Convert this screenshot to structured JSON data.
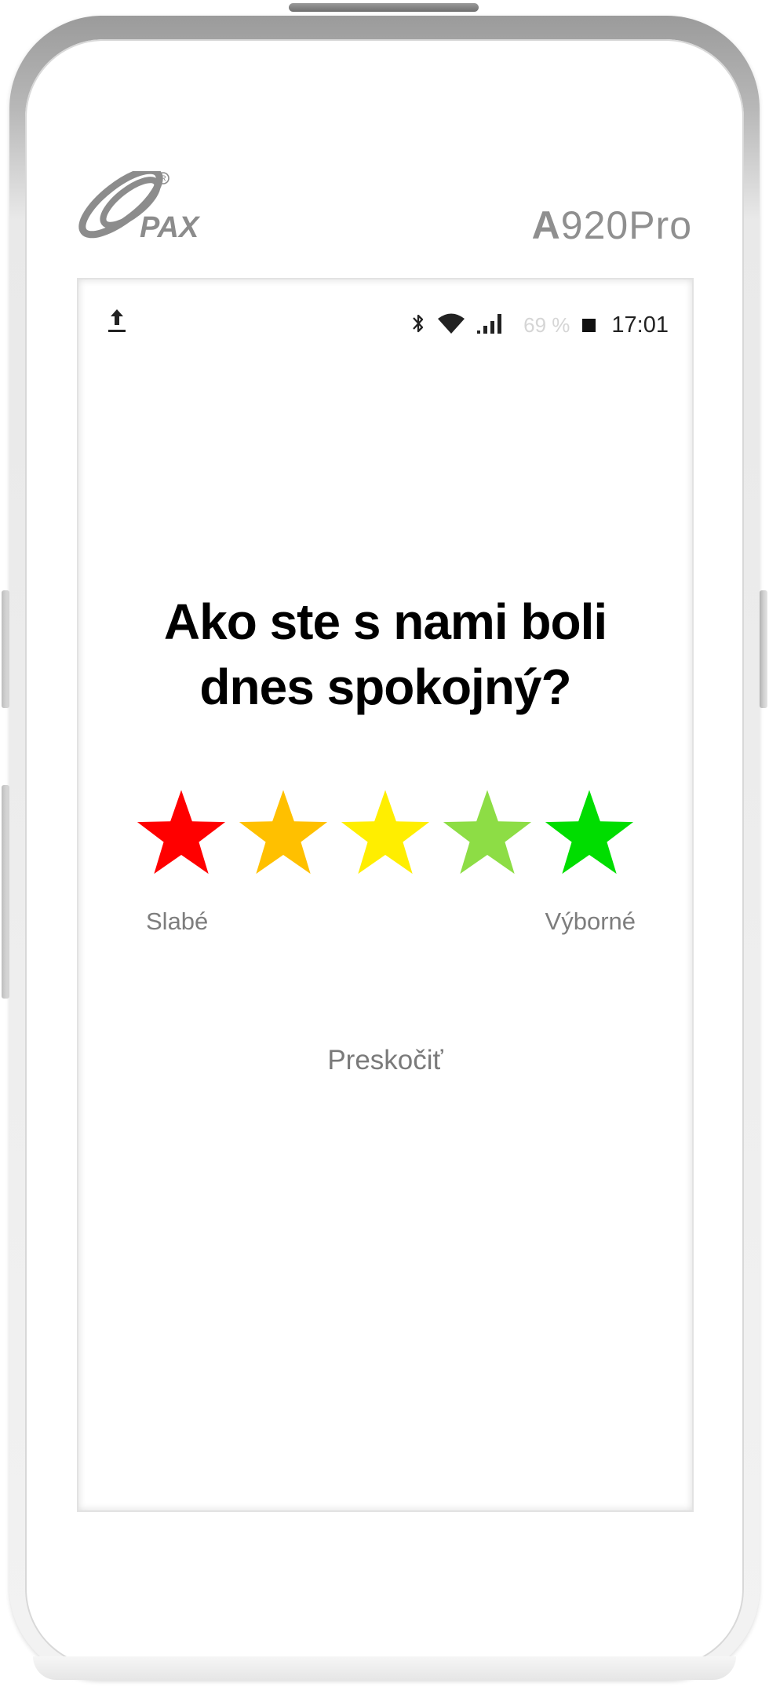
{
  "device": {
    "brand": "PAX",
    "model_bold": "A",
    "model_rest": "920Pro"
  },
  "status_bar": {
    "upload_icon": "upload-icon",
    "bluetooth_icon": "bluetooth-icon",
    "wifi_icon": "wifi-icon",
    "signal_icon": "signal-icon",
    "battery_percent": "69 %",
    "time": "17:01"
  },
  "rating": {
    "question_line1": "Ako ste s nami boli",
    "question_line2": "dnes spokojný?",
    "stars": [
      {
        "value": 1,
        "color": "#ff0000"
      },
      {
        "value": 2,
        "color": "#ffc000"
      },
      {
        "value": 3,
        "color": "#ffee00"
      },
      {
        "value": 4,
        "color": "#8ddd45"
      },
      {
        "value": 5,
        "color": "#00dd00"
      }
    ],
    "label_low": "Slabé",
    "label_high": "Výborné",
    "skip_label": "Preskočiť"
  }
}
